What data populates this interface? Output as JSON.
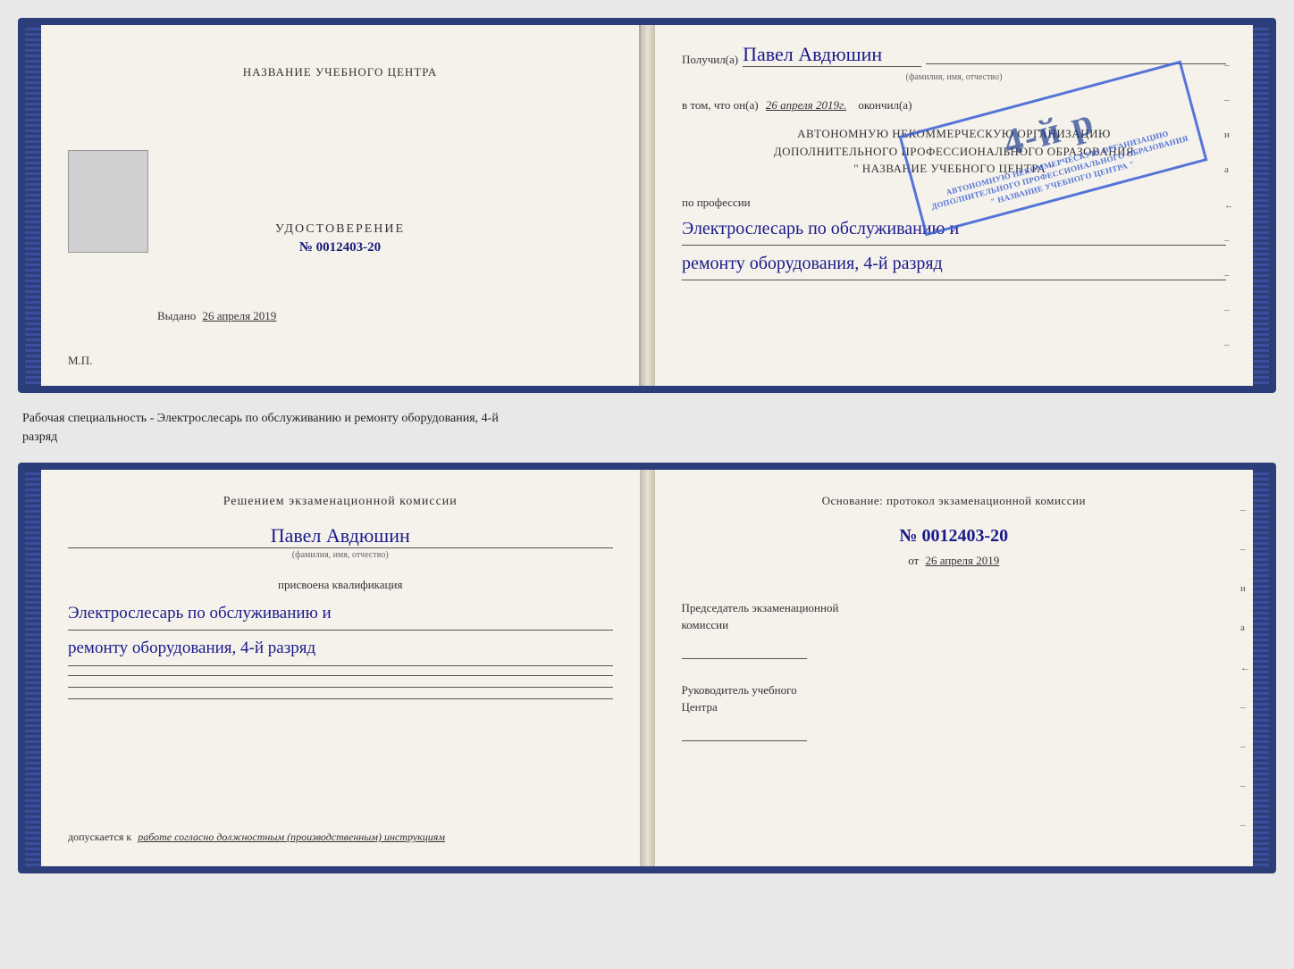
{
  "topDoc": {
    "left": {
      "centerTitle": "НАЗВАНИЕ УЧЕБНОГО ЦЕНТРА",
      "udostoverenie": "УДОСТОВЕРЕНИЕ",
      "number": "№ 0012403-20",
      "vydano": "Выдано",
      "vydanoDate": "26 апреля 2019",
      "mp": "М.П."
    },
    "right": {
      "poluchilLabel": "Получил(а)",
      "recipientName": "Павел Авдюшин",
      "fioSubtitle": "(фамилия, имя, отчество)",
      "vtomLabel": "в том, что он(а)",
      "completionDate": "26 апреля 2019г.",
      "okonchilLabel": "окончил(а)",
      "orgLine1": "АВТОНОМНУЮ НЕКОММЕРЧЕСКУЮ ОРГАНИЗАЦИЮ",
      "orgLine2": "ДОПОЛНИТЕЛЬНОГО ПРОФЕССИОНАЛЬНОГО ОБРАЗОВАНИЯ",
      "orgLine3": "\" НАЗВАНИЕ УЧЕБНОГО ЦЕНТРА \"",
      "poProfessiiLabel": "по профессии",
      "profession1": "Электрослесарь по обслуживанию и",
      "profession2": "ремонту оборудования, 4-й разряд"
    },
    "stamp": {
      "line1": "4-й р",
      "line2": "АВТОНОМНУЮ НЕКОММЕРЧЕСКУЮ ОРГАНИЗАЦИЮ",
      "line3": "ДОПОЛНИТЕЛЬНОГО ПРОФЕССИОНАЛЬНОГО ОБРАЗОВАНИЯ",
      "line4": "НАЗВАНИЕ УЧЕБНОГО ЦЕНТРА"
    }
  },
  "middleText": "Рабочая специальность - Электрослесарь по обслуживанию и ремонту оборудования, 4-й\nразряд",
  "bottomDoc": {
    "left": {
      "reshenieTitle": "Решением экзаменационной комиссии",
      "personName": "Павел Авдюшин",
      "fioSubtitle": "(фамилия, имя, отчество)",
      "prisvoenaText": "присвоена квалификация",
      "qualification1": "Электрослесарь по обслуживанию и",
      "qualification2": "ремонту оборудования, 4-й разряд",
      "dopuskaetsyaLabel": "допускается к",
      "dopuskaetsyaValue": "работе согласно должностным (производственным) инструкциям"
    },
    "right": {
      "osnovanieLine": "Основание: протокол экзаменационной комиссии",
      "protocolNumber": "№ 0012403-20",
      "otLabel": "от",
      "otDate": "26 апреля 2019",
      "predsedatelLabel": "Председатель экзаменационной",
      "komissiiLabel": "комиссии",
      "rukovoditelLabel": "Руководитель учебного",
      "centraLabel": "Центра"
    }
  },
  "edgeDashes": [
    "-",
    "-",
    "и",
    "а",
    "←",
    "-",
    "-",
    "-",
    "-"
  ]
}
